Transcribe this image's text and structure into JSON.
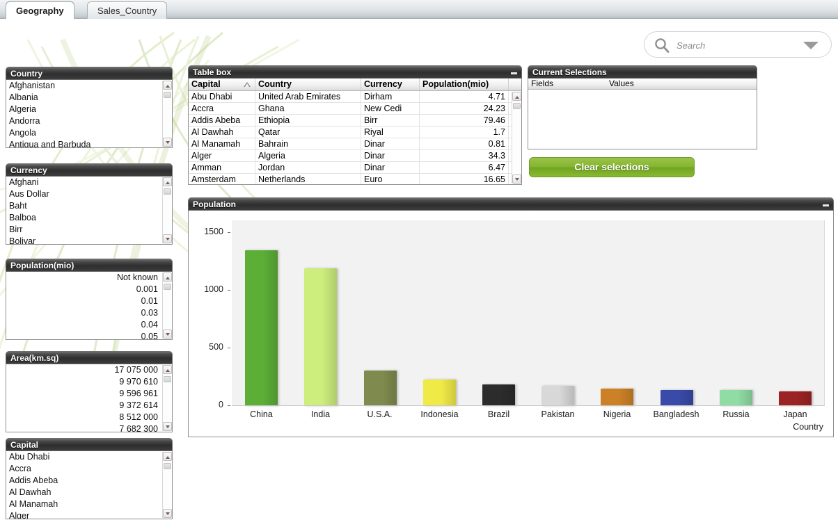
{
  "tabs": [
    {
      "label": "Geography",
      "active": true
    },
    {
      "label": "Sales_Country",
      "active": false
    }
  ],
  "search": {
    "placeholder": "Search",
    "value": ""
  },
  "listboxes": [
    {
      "title": "Country",
      "align": "left",
      "items": [
        "Afghanistan",
        "Albania",
        "Algeria",
        "Andorra",
        "Angola",
        "Antigua and Barbuda"
      ]
    },
    {
      "title": "Currency",
      "align": "left",
      "items": [
        "Afghani",
        "Aus Dollar",
        "Baht",
        "Balboa",
        "Birr",
        "Bolivar"
      ]
    },
    {
      "title": "Population(mio)",
      "align": "right",
      "items": [
        "Not known",
        "0.001",
        "0.01",
        "0.03",
        "0.04",
        "0.05"
      ]
    },
    {
      "title": "Area(km.sq)",
      "align": "right",
      "items": [
        "17 075 000",
        "9 970 610",
        "9 596 961",
        "9 372 614",
        "8 512 000",
        "7 682 300"
      ]
    },
    {
      "title": "Capital",
      "align": "left",
      "items": [
        "Abu Dhabi",
        "Accra",
        "Addis Abeba",
        "Al Dawhah",
        "Al Manamah",
        "Alger"
      ]
    }
  ],
  "tablebox": {
    "title": "Table box",
    "columns": [
      "Capital",
      "Country",
      "Currency",
      "Population(mio)"
    ],
    "sorted_column": "Capital",
    "sort_direction": "ascending",
    "rows": [
      [
        "Abu Dhabi",
        "United Arab Emirates",
        "Dirham",
        "4.71"
      ],
      [
        "Accra",
        "Ghana",
        "New Cedi",
        "24.23"
      ],
      [
        "Addis Abeba",
        "Ethiopia",
        "Birr",
        "79.46"
      ],
      [
        "Al Dawhah",
        "Qatar",
        "Riyal",
        "1.7"
      ],
      [
        "Al Manamah",
        "Bahrain",
        "Dinar",
        "0.81"
      ],
      [
        "Alger",
        "Algeria",
        "Dinar",
        "34.3"
      ],
      [
        "Amman",
        "Jordan",
        "Dinar",
        "6.47"
      ],
      [
        "Amsterdam",
        "Netherlands",
        "Euro",
        "16.65"
      ]
    ]
  },
  "current_selections": {
    "title": "Current Selections",
    "columns": [
      "Fields",
      "Values"
    ],
    "rows": []
  },
  "clear_button": {
    "label": "Clear selections",
    "color": "#85b52f"
  },
  "chart_panel": {
    "title": "Population"
  },
  "chart_data": {
    "type": "bar",
    "title": "Population",
    "xlabel": "Country",
    "ylabel": "",
    "categories": [
      "China",
      "India",
      "U.S.A.",
      "Indonesia",
      "Brazil",
      "Pakistan",
      "Nigeria",
      "Bangladesh",
      "Russia",
      "Japan"
    ],
    "values": [
      1350,
      1190,
      305,
      230,
      185,
      176,
      152,
      140,
      141,
      127
    ],
    "colors": [
      "#5cae37",
      "#cdee7c",
      "#7f8b4e",
      "#f0ea47",
      "#2c2c2c",
      "#d8d8d8",
      "#cc8126",
      "#3a4aa8",
      "#8fdca4",
      "#9c2323"
    ],
    "ylim": [
      0,
      1600
    ],
    "yticks": [
      0,
      500,
      1000,
      1500
    ],
    "ytick_labels": [
      "0",
      "500",
      "1000",
      "1500"
    ],
    "grid": false,
    "legend": "none"
  }
}
